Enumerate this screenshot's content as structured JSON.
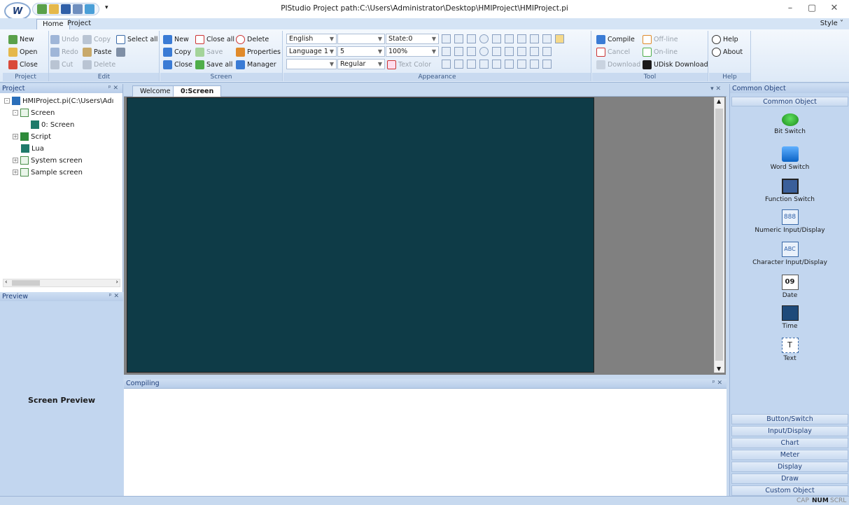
{
  "titlebar": {
    "title": "PIStudio   Project path:C:\\Users\\Administrator\\Desktop\\HMIProject\\HMIProject.pi",
    "logo": "W",
    "min": "–",
    "max": "▢",
    "close": "✕"
  },
  "tabs": {
    "home": "Home",
    "project": "Project",
    "style": "Style ˅"
  },
  "groups": {
    "project": "Project",
    "edit": "Edit",
    "screen": "Screen",
    "appearance": "Appearance",
    "tool": "Tool",
    "help": "Help"
  },
  "project_group": {
    "new": "New",
    "open": "Open",
    "close": "Close"
  },
  "edit_group": {
    "undo": "Undo",
    "redo": "Redo",
    "cut": "Cut",
    "copy": "Copy",
    "paste": "Paste",
    "delete": "Delete",
    "select_all": "Select all"
  },
  "screen_group": {
    "new": "New",
    "copy": "Copy",
    "close": "Close",
    "close_all": "Close all",
    "save": "Save",
    "save_all": "Save all",
    "delete": "Delete",
    "properties": "Properties",
    "manager": "Manager"
  },
  "appearance": {
    "language": "English",
    "language_idx": "Language 1",
    "combo_blank": "",
    "size": "5",
    "style": "Regular",
    "state": "State:0",
    "zoom": "100%",
    "text_color": "Text Color"
  },
  "tool_group": {
    "compile": "Compile",
    "cancel": "Cancel",
    "download": "Download",
    "offline": "Off-line",
    "online": "On-line",
    "udisk": "UDisk Download"
  },
  "help_group": {
    "help": "Help",
    "about": "About"
  },
  "project_panel": {
    "title": "Project",
    "root": "HMIProject.pi(C:\\Users\\Adı",
    "screen": "Screen",
    "screen0": "0: Screen",
    "script": "Script",
    "lua": "Lua",
    "system": "System screen",
    "sample": "Sample screen"
  },
  "preview_panel": {
    "title": "Preview",
    "label": "Screen Preview"
  },
  "doc": {
    "welcome": "Welcome",
    "screen": "0:Screen"
  },
  "compiling": {
    "title": "Compiling"
  },
  "right_panel": {
    "title": "Common Object",
    "sub": "Common Object",
    "tools": [
      "Bit Switch",
      "Word Switch",
      "Function Switch",
      "Numeric Input/Display",
      "Character Input/Display",
      "Date",
      "Time",
      "Text"
    ],
    "categories": [
      "Button/Switch",
      "Input/Display",
      "Chart",
      "Meter",
      "Display",
      "Draw",
      "Custom Object"
    ]
  },
  "status": {
    "cap": "CAP",
    "num": "NUM",
    "scrl": "SCRL"
  }
}
